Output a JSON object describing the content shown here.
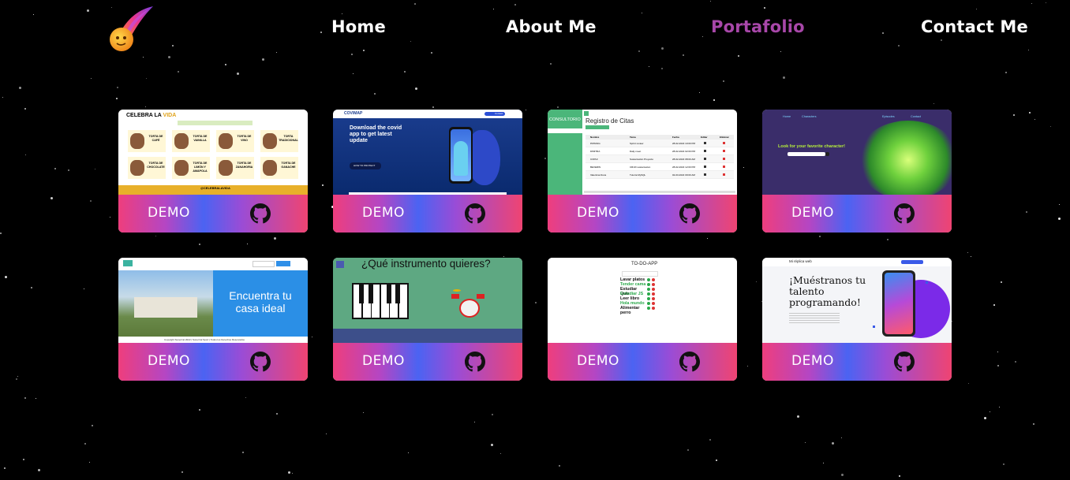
{
  "nav": {
    "logo_icon": "comet-logo-icon",
    "items": [
      {
        "label": "Home",
        "active": false
      },
      {
        "label": "About Me",
        "active": false
      },
      {
        "label": "Portafolio",
        "active": true
      },
      {
        "label": "Contact Me",
        "active": false
      }
    ],
    "active_color": "#a847a9"
  },
  "cards": [
    {
      "demo_label": "DEMO",
      "repo_icon": "github-icon",
      "thumb": {
        "title_a": "CELEBRA LA",
        "title_b": "VIDA",
        "items": [
          "TORTA DE CAFÉ",
          "TORTA DE VAINILLA",
          "TORTA DE VINO",
          "TORTA TRADICIONAL",
          "TORTA DE CHOCOLATE",
          "TORTA DE LIMÓN Y AMAPOLA",
          "TORTA DE ZANAHORIA",
          "TORTA DE GANACHE"
        ],
        "footer": "@CELEBRALAVIDA"
      }
    },
    {
      "demo_label": "DEMO",
      "repo_icon": "github-icon",
      "thumb": {
        "brand": "COVIMAP",
        "headline": "Download the covid app to get latest update",
        "cta": "HOW TO PROTECT",
        "btn": "Contact"
      }
    },
    {
      "demo_label": "DEMO",
      "repo_icon": "github-icon",
      "thumb": {
        "side": "CONSULTORIO",
        "title": "Registro de Citas",
        "cols": [
          "Nombre",
          "Tema",
          "Fecha",
          "Editar",
          "Eliminar"
        ],
        "rows": [
          [
            "PATRAIG",
            "Sprint review",
            "28-02-2022 10:00 PM"
          ],
          [
            "DIMITRA",
            "Daily meet",
            "28-02-2022 02:00 PM"
          ],
          [
            "COPHI",
            "Sustentación Proyecto",
            "28-02-2022 08:00 AM"
          ],
          [
            "BEVERIN",
            "CRUD sustentacion",
            "28-02-2022 12:00 PM"
          ],
          [
            "Valentina Duca",
            "Tutoría MySQL",
            "02-03-2022 09:00 AM"
          ]
        ]
      }
    },
    {
      "demo_label": "DEMO",
      "repo_icon": "github-icon",
      "thumb": {
        "nav": [
          "Home",
          "Characters",
          "Episodes",
          "Contact"
        ],
        "tagline": "Look for your favorite character!"
      }
    },
    {
      "demo_label": "DEMO",
      "repo_icon": "github-icon",
      "thumb": {
        "headline": "Encuentra tu casa ideal",
        "footer": "Copyright Sunerrral 2022 | Sunerrral Sport | Todos los Derechos Reservados"
      }
    },
    {
      "demo_label": "DEMO",
      "repo_icon": "github-icon",
      "thumb": {
        "title": "¿Qué instrumento quieres?"
      }
    },
    {
      "demo_label": "DEMO",
      "repo_icon": "github-icon",
      "thumb": {
        "title": "TO-DO-APP",
        "tasks": [
          {
            "text": "Lavar platos",
            "done": false
          },
          {
            "text": "Tender cama",
            "done": true
          },
          {
            "text": "Estudiar Quiz",
            "done": false
          },
          {
            "text": "Estudiar JS",
            "done": true
          },
          {
            "text": "Leer libro",
            "done": false
          },
          {
            "text": "Hola mundo",
            "done": true
          },
          {
            "text": "Alimentar perro",
            "done": false
          }
        ]
      }
    },
    {
      "demo_label": "DEMO",
      "repo_icon": "github-icon",
      "thumb": {
        "brand": "Mi réplica web",
        "headline": "¡Muéstranos tu talento programando!"
      }
    }
  ]
}
